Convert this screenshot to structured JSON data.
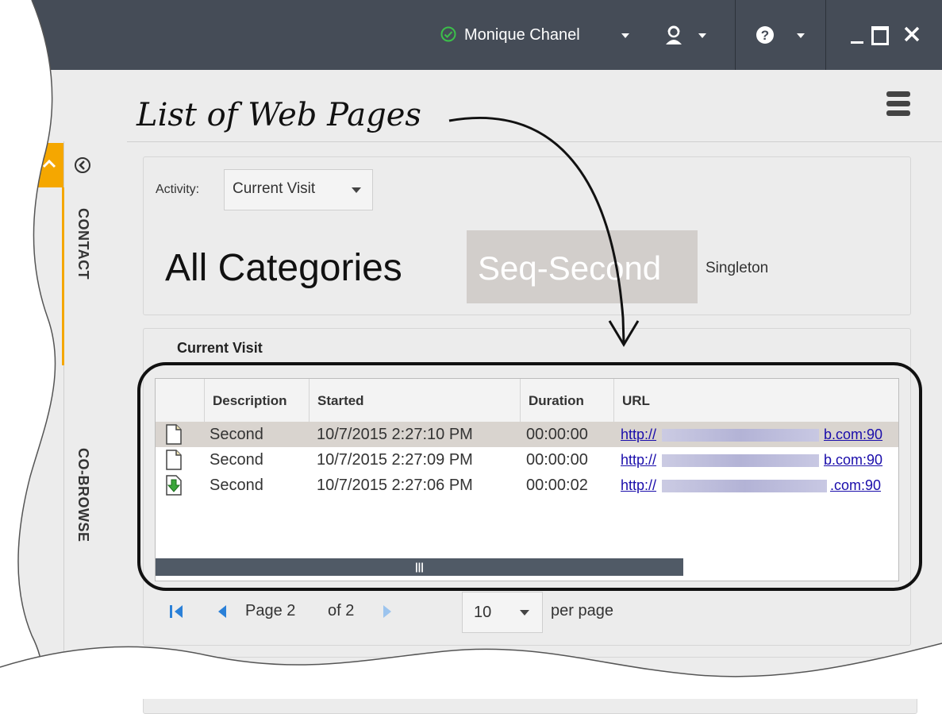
{
  "titlebar": {
    "user_name": "Monique Chanel",
    "status_icon": "check-circle-icon",
    "agent_icon": "agent-icon",
    "help_icon": "help-icon",
    "window_controls": [
      "minimize-icon",
      "maximize-icon",
      "close-icon"
    ]
  },
  "annotation": {
    "label": "List of Web Pages"
  },
  "side_tabs": {
    "contact": "CONTACT",
    "cobrowse": "CO-BROWSE"
  },
  "activity": {
    "label": "Activity:",
    "selected": "Current Visit"
  },
  "categories": {
    "all": "All Categories",
    "seq": "Seq-Second",
    "singleton": "Singleton"
  },
  "visit": {
    "title": "Current Visit",
    "columns": [
      "Description",
      "Started",
      "Duration",
      "URL"
    ],
    "rows": [
      {
        "icon": "page-icon",
        "description": "Second",
        "started": "10/7/2015 2:27:10 PM",
        "duration": "00:00:00",
        "url_start": "http://",
        "url_end": "b.com:90",
        "selected": true
      },
      {
        "icon": "page-icon",
        "description": "Second",
        "started": "10/7/2015 2:27:09 PM",
        "duration": "00:00:00",
        "url_start": "http://",
        "url_end": "b.com:90",
        "selected": false
      },
      {
        "icon": "download-page-icon",
        "description": "Second",
        "started": "10/7/2015 2:27:06 PM",
        "duration": "00:00:02",
        "url_start": "http://",
        "url_end": ".com:90",
        "selected": false
      }
    ],
    "scrollbar_grip": "|||"
  },
  "pager": {
    "page_label": "Page 2",
    "of_label": "of 2",
    "per_page_value": "10",
    "per_page_label": "per page"
  },
  "colors": {
    "titlebar": "#454c57",
    "accent_tab": "#f5a700",
    "highlight": "#d2cecb",
    "selected_row": "#d9d4cf",
    "status_green": "#3cc04a"
  }
}
